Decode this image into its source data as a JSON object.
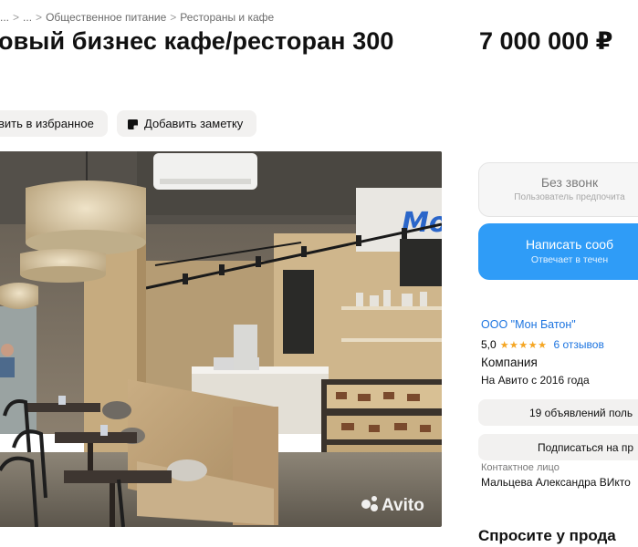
{
  "breadcrumb": {
    "items": [
      "...",
      "...",
      "Общественное питание",
      "Рестораны и кафе"
    ],
    "separator": ">"
  },
  "listing": {
    "title": "овый бизнес кафе/ресторан 300",
    "price": "7 000 000 ₽"
  },
  "actions": {
    "favorite_label": "вить в избранное",
    "note_label": "Добавить заметку"
  },
  "photo": {
    "watermark": "Avito",
    "sign_text": "Mo"
  },
  "contact_buttons": {
    "call_title": "Без звонк",
    "call_subtitle": "Пользователь предпочита",
    "write_title": "Написать сооб",
    "write_subtitle": "Отвечает в течен"
  },
  "seller": {
    "name": "ООО \"Мон Батон\"",
    "rating": "5,0",
    "stars": "★★★★★",
    "reviews": "6 отзывов",
    "type": "Компания",
    "since": "На Авито с 2016 года",
    "ads_button": "19 объявлений поль",
    "subscribe_button": "Подписаться на пр",
    "contact_label": "Контактное лицо",
    "contact_name": "Мальцева Александра ВИкто"
  },
  "ask_heading": "Спросите у прода",
  "colors": {
    "accent": "#2f9cf7",
    "link": "#1c74e0",
    "star": "#f5a623",
    "chip_bg": "#f2f1f0"
  }
}
